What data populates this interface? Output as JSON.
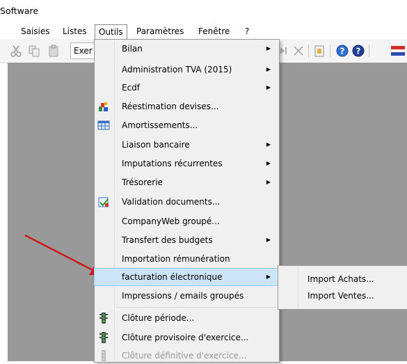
{
  "window": {
    "title": "Software"
  },
  "menubar": {
    "items": [
      "Saisies",
      "Listes",
      "Outils",
      "Paramètres",
      "Fenêtre",
      "?"
    ]
  },
  "toolbar": {
    "exercise_label": "Exer"
  },
  "outils_menu": {
    "items": [
      {
        "label": "Bilan",
        "submenu": true
      },
      {
        "label": "Administration TVA (2015)",
        "submenu": true
      },
      {
        "label": "Ecdf",
        "submenu": true
      },
      {
        "label": "Réestimation devises...",
        "icon": "currency-revaluation-icon"
      },
      {
        "label": "Amortissements...",
        "icon": "table-grid-icon"
      },
      {
        "label": "Liaison bancaire",
        "submenu": true
      },
      {
        "label": "Imputations récurrentes",
        "submenu": true
      },
      {
        "label": "Trésorerie",
        "submenu": true
      },
      {
        "label": "Validation documents...",
        "icon": "document-check-icon"
      },
      {
        "label": "CompanyWeb groupé..."
      },
      {
        "label": "Transfert des budgets",
        "submenu": true
      },
      {
        "label": "Importation rémunération"
      },
      {
        "label": "facturation électronique",
        "submenu": true,
        "highlighted": true
      },
      {
        "label": "Impressions / emails groupés"
      },
      {
        "label": "Clôture période...",
        "icon": "traffic-light-icon"
      },
      {
        "label": "Clôture provisoire d'exercice...",
        "icon": "traffic-light-icon"
      },
      {
        "label": "Clôture définitive d'exercice...",
        "icon": "traffic-light-icon",
        "disabled": true
      }
    ]
  },
  "facturation_submenu": {
    "items": [
      "Import Achats...",
      "Import Ventes..."
    ]
  },
  "colors": {
    "highlight": "#cce4f7",
    "workspace": "#999999",
    "annotation_arrow": "#cc1a1a"
  }
}
